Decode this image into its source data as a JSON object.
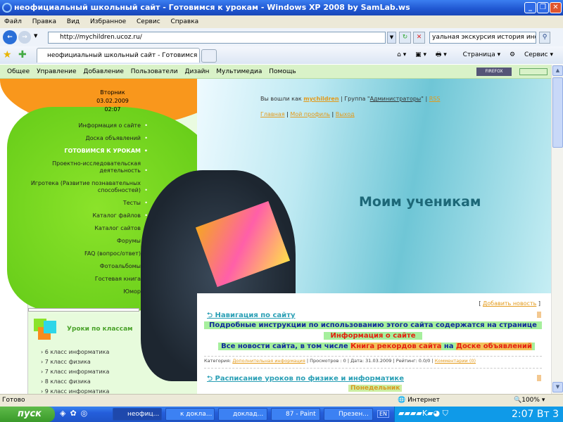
{
  "window": {
    "title": "неофициальный школьный сайт - Готовимся к урокам - Windows XP 2008 by SamLab.ws",
    "minimize": "_",
    "maximize": "❐",
    "close": "✕"
  },
  "menu": [
    "Файл",
    "Правка",
    "Вид",
    "Избранное",
    "Сервис",
    "Справка"
  ],
  "address": {
    "url": "http://mychildren.ucoz.ru/",
    "search_value": "уальная экскурсия история  информ"
  },
  "tab": {
    "label": "неофициальный школьный сайт - Готовимся к уро..."
  },
  "toolbar": {
    "page": "Страница",
    "tools": "Сервис"
  },
  "admin_bar": {
    "items": [
      "Общее",
      "Управление",
      "Добавление",
      "Пользователи",
      "Дизайн",
      "Мультимедиа",
      "Помощь"
    ],
    "badge": "FIREFOX"
  },
  "sidebar": {
    "date": {
      "day": "Вторник",
      "date": "03.02.2009",
      "time": "02:07"
    },
    "nav": [
      "Информация о сайте",
      "Доска объявлений",
      "ГОТОВИМСЯ К УРОКАМ",
      "Проектно-исследовательская деятельность",
      "Игротека (Развитие познавательных способностей)",
      "Тесты",
      "Каталог файлов",
      "Каталог сайтов",
      "Форумы",
      "FAQ (вопрос/ответ)",
      "Фотоальбомы",
      "Гостевая книга",
      "Юмор"
    ],
    "classes_title": "Уроки по классам",
    "classes": [
      "6 класс информатика",
      "7 класс физика",
      "7 класс информатика",
      "8 класс физика",
      "9 класс информатика"
    ]
  },
  "header": {
    "login_prefix": "Вы вошли как",
    "user": "mychildren",
    "group_prefix": "| Группа \"",
    "group": "Администраторы",
    "group_suffix": "\" |",
    "rss": "RSS",
    "links": [
      "Главная",
      "Мой профиль",
      "Выход"
    ],
    "hero": "Моим ученикам"
  },
  "main": {
    "add_news": "Добавить новость",
    "post1": {
      "title": "Навигация по сайту",
      "line1": "Подробные инструкции по использованию этого сайта содержатся на странице",
      "line2": "Информация о сайте",
      "line3_a": "Все новости сайта, в том числе",
      "line3_b": "Книга рекордов сайта",
      "line3_c": "на",
      "line3_d": "Доске объявлений",
      "meta_cat": "Категория:",
      "category": "Дополнительная информация",
      "meta_rest": "| Просмотров : 0 | Дата: 31.03.2009 | Рейтинг: 0.0/0 |",
      "comments": "Комментарии (0)"
    },
    "post2": {
      "title": "Расписание уроков по физике и информатике",
      "day": "Понедельник"
    }
  },
  "status": {
    "text": "Готово",
    "zone": "Интернет",
    "zoom": "100%"
  },
  "taskbar": {
    "start": "пуск",
    "tasks": [
      "неофиц...",
      "к докла...",
      "доклад...",
      "87 - Paint",
      "Презен..."
    ],
    "lang": "EN",
    "clock": "2:07 Вт 3"
  }
}
